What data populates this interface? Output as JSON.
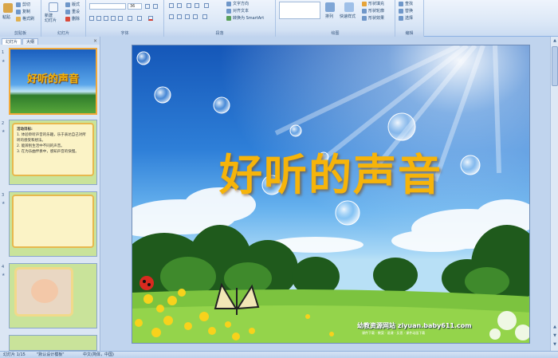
{
  "ribbon": {
    "clipboard": {
      "paste": "粘贴",
      "cut": "剪切",
      "copy": "复制",
      "format_painter": "格式刷",
      "label": "剪贴板"
    },
    "slides": {
      "new_slide": "新建\n幻灯片",
      "layout": "版式",
      "reset": "重设",
      "delete": "删除",
      "label": "幻灯片"
    },
    "font": {
      "font_size": "36",
      "label": "字体"
    },
    "paragraph": {
      "text_direction": "文字方向",
      "align_text": "对齐文本",
      "convert_smartart": "转换为 SmartArt",
      "label": "段落"
    },
    "drawing": {
      "arrange": "排列",
      "quick_styles": "快速样式",
      "shape_fill": "形状填充",
      "shape_outline": "形状轮廓",
      "shape_effects": "形状效果",
      "label": "绘图"
    },
    "editing": {
      "find": "查找",
      "replace": "替换",
      "select": "选择",
      "label": "编辑"
    }
  },
  "panel": {
    "tabs": [
      "幻灯片",
      "大纲"
    ],
    "close": "×",
    "thumbs": [
      {
        "num": "1",
        "title": "好听的声音"
      },
      {
        "num": "2",
        "heading": "活动目标:",
        "lines": [
          "1. 体验聆听声音的乐趣，乐于表达自己对所听的感受和想法。",
          "2. 能辨别生活中不同的声音。",
          "3. 在为乐曲伴奏中，感知声音的快慢。"
        ]
      },
      {
        "num": "3"
      },
      {
        "num": "4"
      }
    ]
  },
  "slide": {
    "title": "好听的声音",
    "watermark": "幼教资源网站 ziyuan.baby611.com",
    "watermark_sub": "课件下载 · 教案 · 说课 · 反思 · 课件动画下载"
  },
  "status": {
    "slide_info": "幻灯片 1/15",
    "theme": "\"默认设计模板\"",
    "language": "中文(简体，中国)"
  }
}
